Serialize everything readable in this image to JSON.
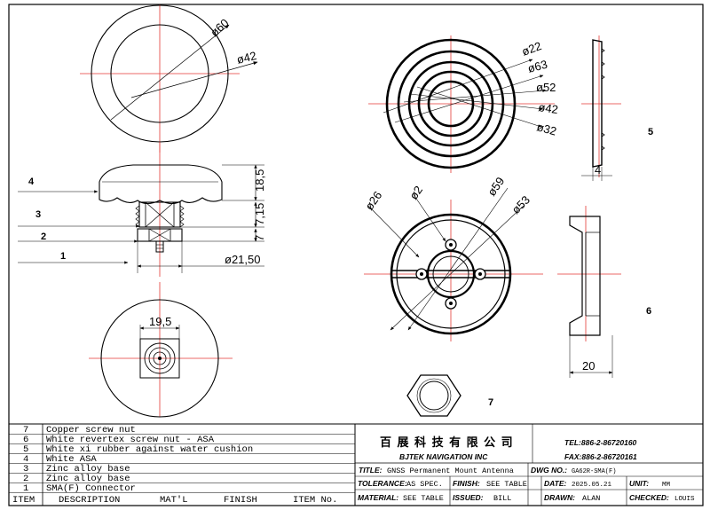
{
  "callouts": {
    "c1": "1",
    "c2": "2",
    "c3": "3",
    "c4": "4",
    "c5": "5",
    "c6": "6",
    "c7": "7"
  },
  "dims": {
    "top_d60": "ø60",
    "top_d42": "ø42",
    "side_18_5": "18,5",
    "side_7_15": "7,15",
    "side_7": "7",
    "side_d21_50": "ø21,50",
    "bottom_19_5": "19,5",
    "ring_d22": "ø22",
    "ring_d63": "ø63",
    "ring_d52": "ø52",
    "ring_d42": "ø42",
    "ring_d32": "ø32",
    "ring_4": "4",
    "nut_d26": "ø26",
    "nut_d2": "ø2",
    "nut_d59": "ø59",
    "nut_d53": "ø53",
    "nut_20": "20"
  },
  "bom": {
    "rows": [
      {
        "item": "7",
        "desc": "Copper screw nut"
      },
      {
        "item": "6",
        "desc": "White revertex screw nut - ASA"
      },
      {
        "item": "5",
        "desc": "White xi rubber against water cushion"
      },
      {
        "item": "4",
        "desc": "White ASA"
      },
      {
        "item": "3",
        "desc": "Zinc alloy base"
      },
      {
        "item": "2",
        "desc": "Zinc alloy base"
      },
      {
        "item": "1",
        "desc": "SMA(F) Connector"
      }
    ],
    "headers": {
      "item": "ITEM",
      "desc": "DESCRIPTION",
      "mat": "MAT'L",
      "finish": "FINISH",
      "itemno": "ITEM No."
    }
  },
  "title_block": {
    "company_cn": "百 展 科 技 有 限 公 司",
    "company_en": "BJTEK NAVIGATION INC",
    "tel": "TEL:886-2-86720160",
    "fax": "FAX:886-2-86720161",
    "title_label": "TITLE:",
    "title_value": "GNSS Permanent Mount Antenna",
    "dwg_label": "DWG NO.:",
    "dwg_value": "GA62R-SMA(F)",
    "tolerance_label": "TOLERANCE:",
    "tolerance_value": "AS SPEC.",
    "finish_label": "FINISH:",
    "finish_value": "SEE TABLE",
    "date_label": "DATE:",
    "date_value": "2025.05.21",
    "unit_label": "UNIT:",
    "unit_value": "MM",
    "material_label": "MATERIAL:",
    "material_value": "SEE TABLE",
    "issued_label": "ISSUED:",
    "issued_value": "BILL",
    "drawn_label": "DRAWN:",
    "drawn_value": "ALAN",
    "checked_label": "CHECKED:",
    "checked_value": "LOUIS"
  }
}
